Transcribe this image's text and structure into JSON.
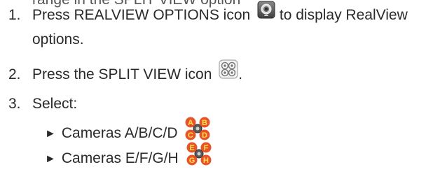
{
  "partial_line": "range in the SPLIT VIEW option",
  "steps": [
    {
      "number": "1.",
      "text_before": "Press REALVIEW OPTIONS icon",
      "text_after": "to display RealView",
      "continuation": "options.",
      "icon": "realview-options-icon"
    },
    {
      "number": "2.",
      "text_before": "Press the SPLIT VIEW icon",
      "text_after": ".",
      "icon": "split-view-icon"
    },
    {
      "number": "3.",
      "text_before": "Select:"
    }
  ],
  "options": [
    {
      "bullet": "►",
      "label": "Cameras A/B/C/D",
      "icon": "cameras-abcd-icon",
      "letters": [
        "A",
        "B",
        "C",
        "D"
      ]
    },
    {
      "bullet": "►",
      "label": "Cameras E/F/G/H",
      "icon": "cameras-efgh-icon",
      "letters": [
        "E",
        "F",
        "G",
        "H"
      ]
    }
  ],
  "colors": {
    "text": "#2a2a2a",
    "camera_badge": "#e8542a",
    "camera_letter": "#ffe04a",
    "icon_gray": "#9a9a9a"
  }
}
